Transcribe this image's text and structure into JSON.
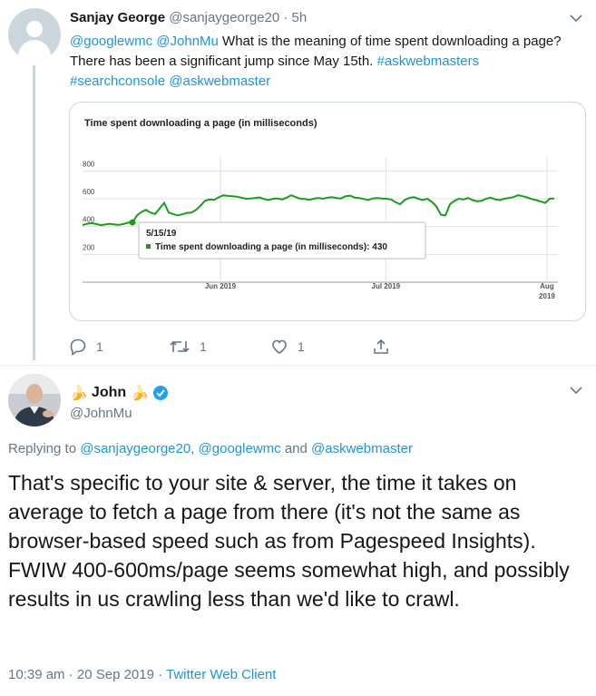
{
  "tweet1": {
    "name": "Sanjay George",
    "handle": "@sanjaygeorge20",
    "separator": "·",
    "time": "5h",
    "text_parts": {
      "m1": "@googlewmc",
      "m2": "@JohnMu",
      "body1": " What is the meaning of time spent downloading a page? There has been a significant jump since May 15th. ",
      "h1": "#askwebmasters",
      "h2": "#searchconsole",
      "m3": "@askwebmaster"
    },
    "reply_count": "1",
    "retweet_count": "1",
    "like_count": "1"
  },
  "chart_data": {
    "type": "line",
    "title": "Time spent downloading a page (in milliseconds)",
    "y_ticks": [
      "800",
      "600",
      "400",
      "200"
    ],
    "x_ticks": [
      "Jun 2019",
      "Jul 2019",
      "Aug 2019"
    ],
    "ylim": [
      0,
      900
    ],
    "grid": true,
    "series": [
      {
        "name": "Time spent downloading a page (in milliseconds)",
        "color": "#1a9c1a",
        "values": [
          410,
          420,
          425,
          418,
          410,
          415,
          420,
          415,
          412,
          418,
          428,
          430,
          480,
          505,
          520,
          500,
          490,
          530,
          570,
          500,
          490,
          480,
          488,
          498,
          500,
          520,
          550,
          585,
          595,
          592,
          610,
          625,
          620,
          618,
          615,
          608,
          600,
          602,
          605,
          610,
          598,
          590,
          600,
          602,
          595,
          608,
          625,
          612,
          600,
          598,
          592,
          600,
          605,
          600,
          608,
          612,
          605,
          602,
          618,
          622,
          608,
          605,
          598,
          590,
          602,
          605,
          602,
          600,
          595,
          575,
          560,
          590,
          605,
          612,
          600,
          590,
          600,
          578,
          545,
          485,
          480,
          560,
          585,
          600,
          595,
          605,
          590,
          582,
          585,
          600,
          608,
          595,
          590,
          600,
          605,
          612,
          625,
          618,
          610,
          598,
          590,
          580,
          570,
          600,
          602
        ]
      }
    ],
    "tooltip": {
      "date": "5/15/19",
      "label": "Time spent downloading a page (in milliseconds): 430"
    }
  },
  "tweet2": {
    "name": "John",
    "handle": "@JohnMu",
    "replying_prefix": "Replying to ",
    "replying_1": "@sanjaygeorge20",
    "replying_sep": ", ",
    "replying_2": "@googlewmc",
    "replying_and": " and ",
    "replying_3": "@askwebmaster",
    "body": "That's specific to your site & server, the time it takes on average to fetch a page from there (it's not the same as browser-based speed such as from Pagespeed Insights). FWIW 400-600ms/page seems somewhat high, and possibly results in us crawling less than we'd like to crawl.",
    "timestamp": "10:39 am · 20 Sep 2019 · ",
    "client": "Twitter Web Client"
  }
}
